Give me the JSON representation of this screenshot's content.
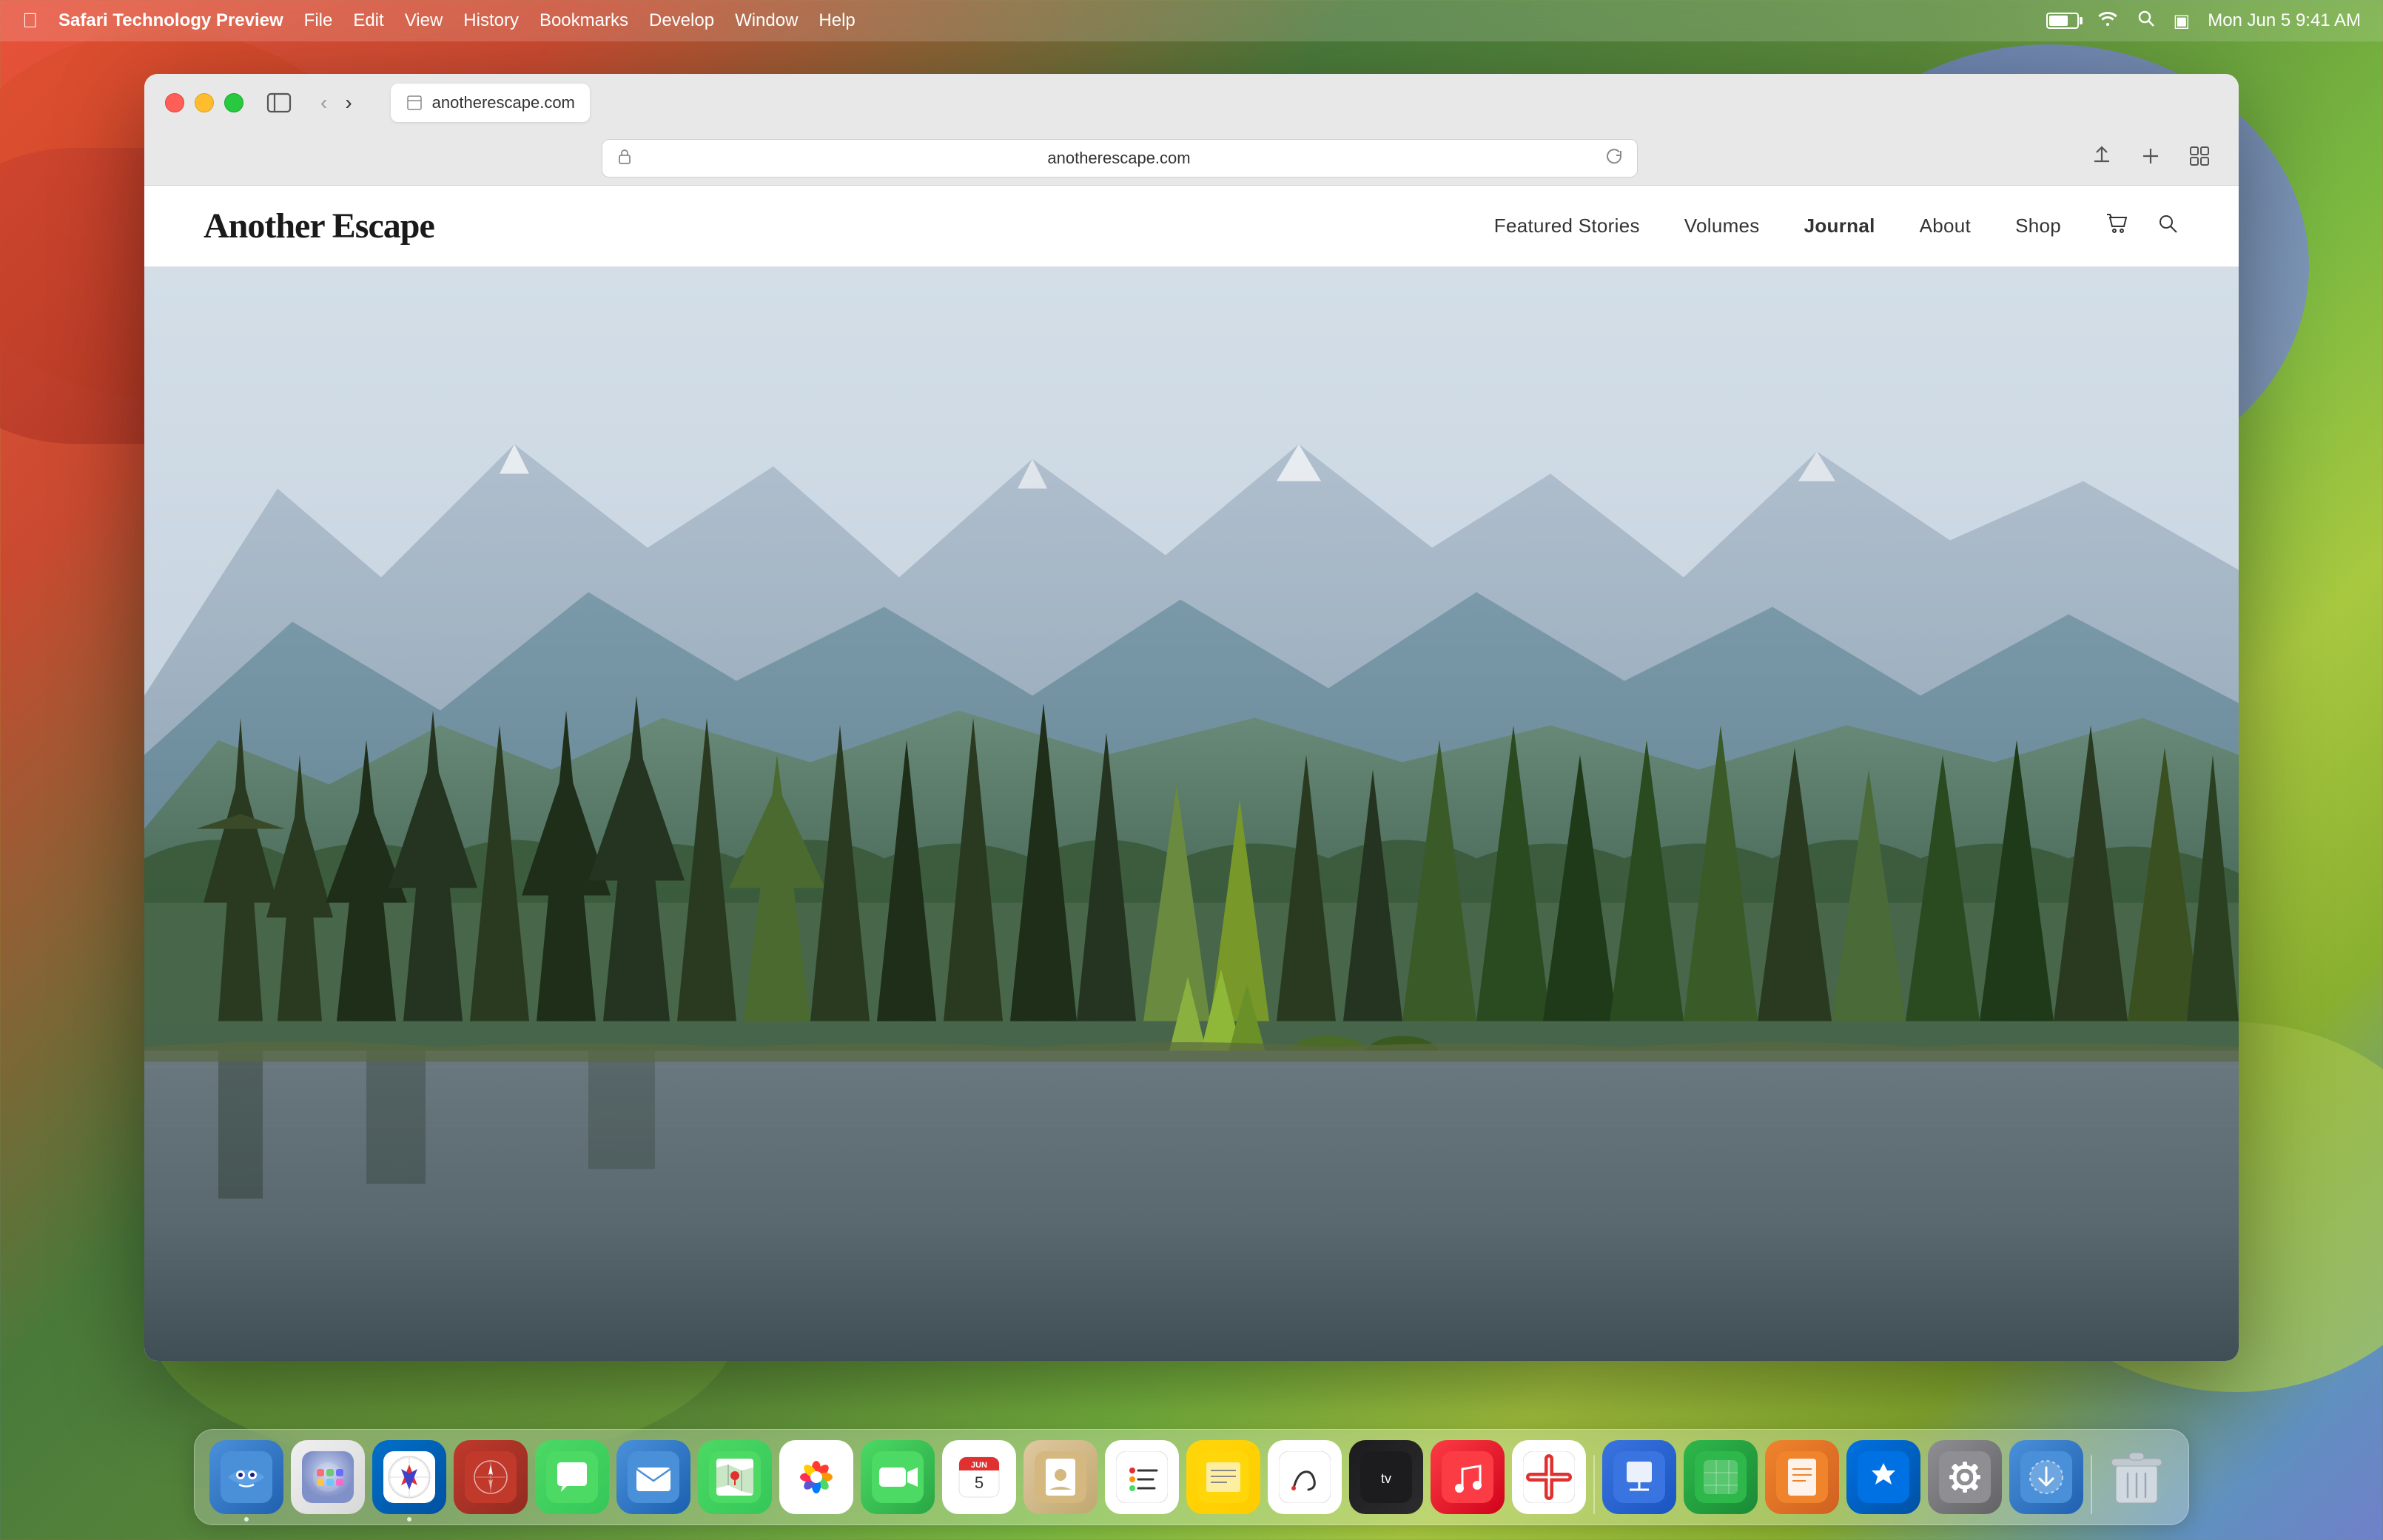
{
  "desktop": {
    "wallpaper_description": "macOS Sonoma gradient wallpaper"
  },
  "menubar": {
    "apple_label": "",
    "app_name": "Safari Technology Preview",
    "items": [
      "File",
      "Edit",
      "View",
      "History",
      "Bookmarks",
      "Develop",
      "Window",
      "Help"
    ],
    "clock": "Mon Jun 5  9:41 AM"
  },
  "browser": {
    "title": "Safari Technology Preview",
    "address_bar": {
      "url": "anotherescape.com",
      "lock_icon": "🔒",
      "refresh_icon": "↻",
      "page_icon": "⊞"
    },
    "toolbar_buttons": {
      "share": "↑",
      "new_tab": "+",
      "tab_overview": "⊡"
    }
  },
  "website": {
    "logo": "Another Escape",
    "nav_links": [
      {
        "label": "Featured Stories",
        "bold": false
      },
      {
        "label": "Volumes",
        "bold": false
      },
      {
        "label": "Journal",
        "bold": true
      },
      {
        "label": "About",
        "bold": false
      },
      {
        "label": "Shop",
        "bold": false
      }
    ],
    "hero": {
      "description": "Scenic landscape with forest trees, lake, and mountains"
    }
  },
  "dock": {
    "items": [
      {
        "name": "Finder",
        "class": "icon-finder",
        "emoji": "🖥",
        "has_dot": true
      },
      {
        "name": "Launchpad",
        "class": "icon-launchpad",
        "emoji": "🚀",
        "has_dot": false
      },
      {
        "name": "Safari",
        "class": "icon-safari",
        "emoji": "🧭",
        "has_dot": true
      },
      {
        "name": "Compass",
        "class": "icon-compass",
        "emoji": "🎯",
        "has_dot": false
      },
      {
        "name": "Messages",
        "class": "icon-messages",
        "emoji": "💬",
        "has_dot": false
      },
      {
        "name": "Mail",
        "class": "icon-mail",
        "emoji": "✉️",
        "has_dot": false
      },
      {
        "name": "Maps",
        "class": "icon-maps",
        "emoji": "🗺",
        "has_dot": false
      },
      {
        "name": "Photos",
        "class": "icon-photos",
        "emoji": "🌸",
        "has_dot": false
      },
      {
        "name": "FaceTime",
        "class": "icon-facetime",
        "emoji": "📹",
        "has_dot": false
      },
      {
        "name": "Calendar",
        "class": "icon-calendar",
        "emoji": "📅",
        "has_dot": false
      },
      {
        "name": "Contacts",
        "class": "icon-contacts",
        "emoji": "👤",
        "has_dot": false
      },
      {
        "name": "Reminders",
        "class": "icon-reminders",
        "emoji": "☑️",
        "has_dot": false
      },
      {
        "name": "Notes",
        "class": "icon-notes",
        "emoji": "📝",
        "has_dot": false
      },
      {
        "name": "Freeform",
        "class": "icon-freeform",
        "emoji": "✏️",
        "has_dot": false
      },
      {
        "name": "Apple TV",
        "class": "icon-appletv",
        "emoji": "📺",
        "has_dot": false
      },
      {
        "name": "Music",
        "class": "icon-music",
        "emoji": "🎵",
        "has_dot": false
      },
      {
        "name": "News",
        "class": "icon-news",
        "emoji": "📰",
        "has_dot": false
      },
      {
        "name": "Keynote",
        "class": "icon-keynote",
        "emoji": "📊",
        "has_dot": false
      },
      {
        "name": "Numbers",
        "class": "icon-numbers",
        "emoji": "📈",
        "has_dot": false
      },
      {
        "name": "Pages",
        "class": "icon-pages",
        "emoji": "📄",
        "has_dot": false
      },
      {
        "name": "App Store",
        "class": "icon-appstore",
        "emoji": "🅰️",
        "has_dot": false
      },
      {
        "name": "System Preferences",
        "class": "icon-systemprefs",
        "emoji": "⚙️",
        "has_dot": false
      },
      {
        "name": "Downloads",
        "class": "icon-downloads",
        "emoji": "⬇️",
        "has_dot": false
      },
      {
        "name": "Trash",
        "class": "icon-trash",
        "emoji": "🗑",
        "has_dot": false
      }
    ]
  }
}
